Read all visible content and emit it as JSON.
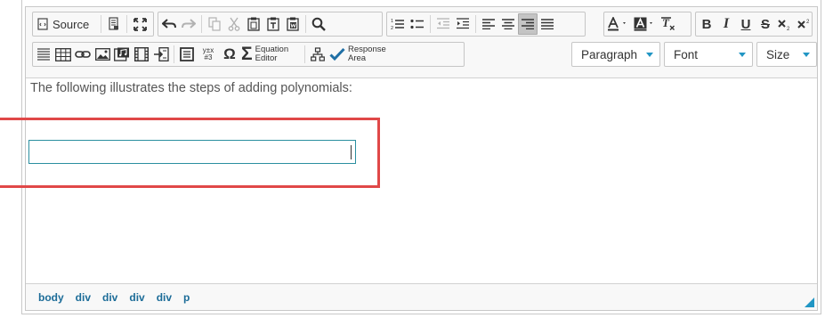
{
  "toolbar": {
    "source_label": "Source",
    "equation_editor_label_1": "Equation",
    "equation_editor_label_2": "Editor",
    "response_area_label_1": "Response",
    "response_area_label_2": "Area",
    "format_value": "Paragraph",
    "font_value": "Font",
    "size_value": "Size",
    "bold_glyph": "B",
    "italic_glyph": "I",
    "underline_glyph": "U",
    "strike_glyph": "S",
    "omega_glyph": "Ω",
    "sigma_glyph": "Σ",
    "variable_glyph_1": "y±x",
    "variable_glyph_2": "#3"
  },
  "content": {
    "paragraph": "The following illustrates the steps of adding polynomials:"
  },
  "statusbar": {
    "path": [
      "body",
      "div",
      "div",
      "div",
      "div",
      "p"
    ]
  },
  "colors": {
    "accent": "#2196c4",
    "highlight": "#e04848",
    "input_border": "#2b8fa0"
  }
}
